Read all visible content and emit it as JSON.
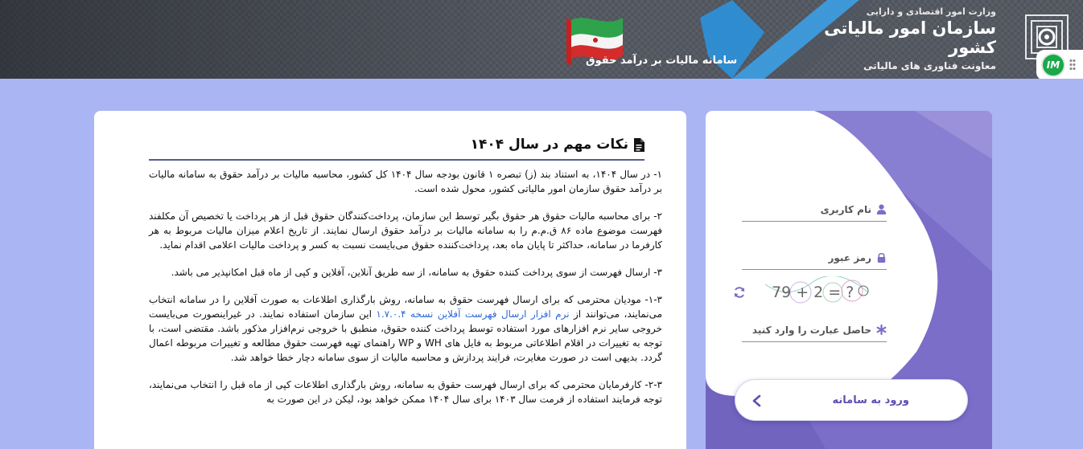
{
  "header": {
    "ministry": "وزارت امور اقتصادی و دارایی",
    "org_name": "سازمان امور مالیاتی کشور",
    "deputy": "معاونت فناوری های مالیاتی",
    "system_title": "سامانه مالیات بر درآمد حقوق",
    "badge_text": "IM"
  },
  "notes": {
    "title": "نکات مهم در سال ۱۴۰۴",
    "items": [
      "۱- در سال ۱۴۰۴، به استناد بند (ز) تبصره ۱ قانون بودجه سال ۱۴۰۴ کل کشور، محاسبه مالیات بر درآمد حقوق به سامانه مالیات بر درآمد حقوق سازمان امور مالیاتی کشور، محول شده است.",
      "۲- برای محاسبه مالیات حقوق هر حقوق بگیر توسط این سازمان، پرداخت‌کنندگان حقوق قبل از هر پرداخت یا تخصیص آن مکلفند فهرست موضوع ماده ۸۶ ق.م.م را به سامانه مالیات بر درآمد حقوق ارسال نمایند. از تاریخ اعلام میزان مالیات مربوط به هر کارفرما در سامانه، حداکثر تا پایان ماه بعد، پرداخت‌کننده حقوق می‌بایست نسبت به کسر و پرداخت مالیات اعلامی اقدام نماید.",
      "۳- ارسال فهرست از سوی پرداخت کننده حقوق به سامانه، از سه طریق آنلاین، آفلاین و کپی از ماه قبل امکانپذیر می باشد."
    ],
    "item4_before": "۱-۳- مودیان محترمی که برای ارسال فهرست حقوق به سامانه، روش بارگذاری اطلاعات به صورت آفلاین را در سامانه انتخاب می‌نمایند، می‌توانند از ",
    "item4_link": "نرم افزار ارسال فهرست آفلاین نسخه ۱.۷.۰.۴",
    "item4_after": " این سازمان استفاده نمایند. در غیراینصورت می‌بایست خروجی سایر نرم افزارهای مورد استفاده توسط پرداخت کننده حقوق، منطبق با خروجی نرم‌افزار مذکور باشد. مقتضی است، با توجه به تغییرات در اقلام اطلاعاتی مربوط به فایل های WH و WP راهنمای تهیه فهرست حقوق مطالعه و تغییرات مربوطه اعمال گردد. بدیهی است در صورت مغایرت، فرایند پردازش و محاسبه مالیات از سوی سامانه دچار خطا خواهد شد.",
    "item5": "۲-۳- کارفرمایان محترمی که برای ارسال فهرست حقوق به سامانه، روش بارگذاری اطلاعات کپی از ماه قبل را انتخاب می‌نمایند، توجه فرمایند استفاده از فرمت سال ۱۴۰۳ برای سال ۱۴۰۴ ممکن خواهد بود، لیکن در این صورت به"
  },
  "login": {
    "username_label": "نام کاربری",
    "password_label": "رمز عبور",
    "captcha_text": "79 + 2 = ?",
    "captcha_label": "حاصل عبارت را وارد کنید",
    "submit_label": "ورود به سامانه"
  },
  "colors": {
    "page_bg": "#aab5f3",
    "panel": "#7b6ec8",
    "accent": "#5b4fb3",
    "link": "#2a6ad8",
    "badge": "#1aa84a"
  }
}
